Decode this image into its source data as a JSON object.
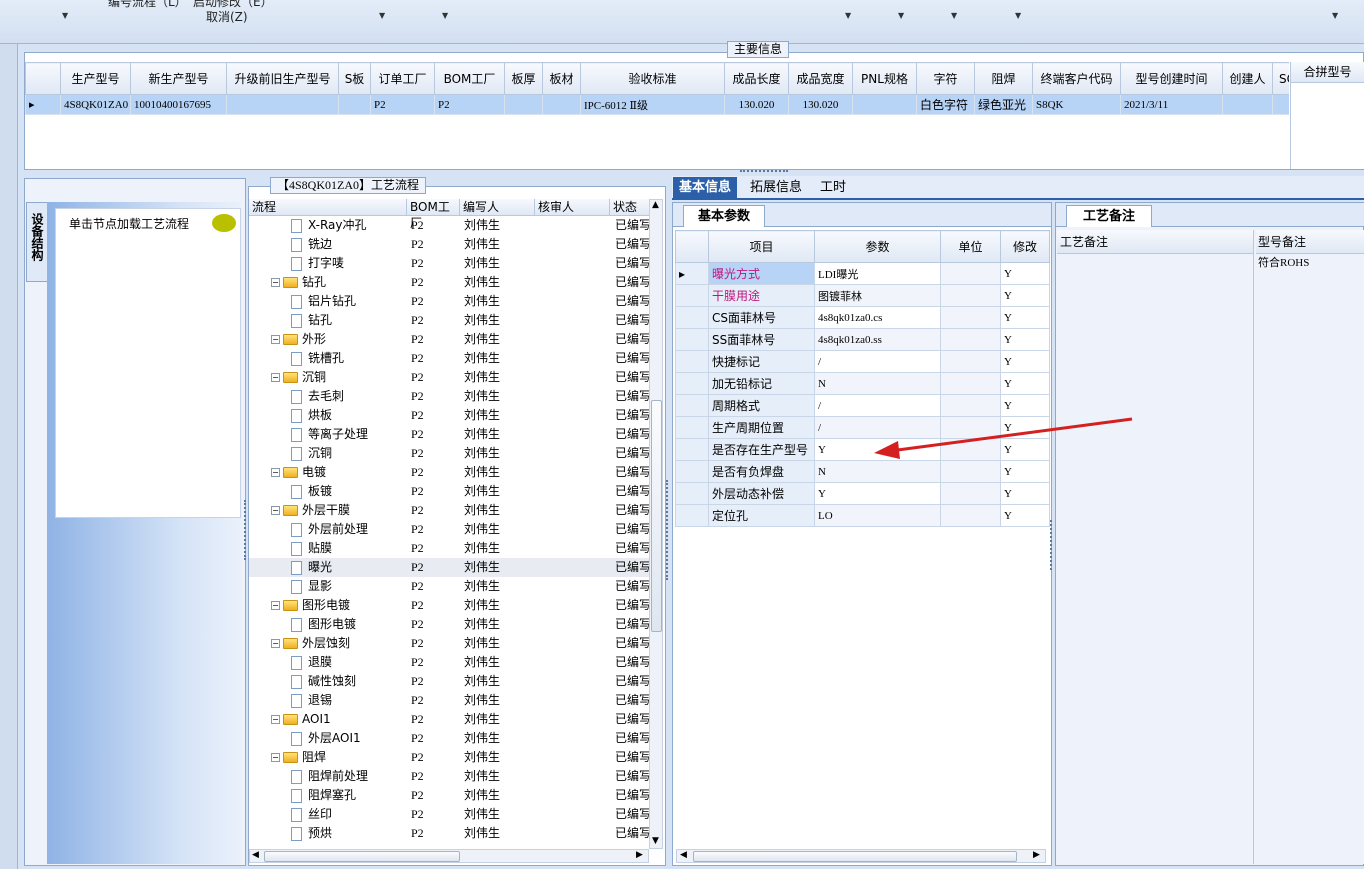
{
  "toolbar": {
    "item1": "编号流程（L）",
    "item2": "启动修改（E）",
    "cancel": "取消(Z)"
  },
  "main_info": {
    "legend": "主要信息",
    "columns": [
      "生产型号",
      "新生产型号",
      "升级前旧生产型号",
      "S板",
      "订单工厂",
      "BOM工厂",
      "板厚",
      "板材",
      "验收标准",
      "成品长度",
      "成品宽度",
      "PNL规格",
      "字符",
      "阻焊",
      "终端客户代码",
      "型号创建时间",
      "创建人",
      "SO"
    ],
    "row": [
      "4S8QK01ZA0",
      "10010400167695",
      "",
      "",
      "P2",
      "P2",
      "",
      "",
      "IPC-6012 Ⅱ级",
      "130.020",
      "130.020",
      "",
      "白色字符",
      "绿色亚光",
      "S8QK",
      "2021/3/11",
      "",
      ""
    ],
    "merge_header": "合拼型号"
  },
  "left_panel": {
    "vertical_tab": "设备结构",
    "hint": "单击节点加载工艺流程"
  },
  "process_flow": {
    "legend": "【4S8QK01ZA0】工艺流程",
    "columns": [
      "流程",
      "BOM工厂",
      "编写人",
      "核审人",
      "状态"
    ],
    "rows": [
      {
        "level": 2,
        "type": "doc",
        "name": "X-Ray冲孔",
        "bom": "P2",
        "writer": "刘伟生",
        "status": "已编写"
      },
      {
        "level": 2,
        "type": "doc",
        "name": "铣边",
        "bom": "P2",
        "writer": "刘伟生",
        "status": "已编写"
      },
      {
        "level": 2,
        "type": "doc",
        "name": "打字唛",
        "bom": "P2",
        "writer": "刘伟生",
        "status": "已编写"
      },
      {
        "level": 1,
        "type": "folder",
        "name": "钻孔",
        "bom": "P2",
        "writer": "刘伟生",
        "status": "已编写"
      },
      {
        "level": 2,
        "type": "doc",
        "name": "铝片钻孔",
        "bom": "P2",
        "writer": "刘伟生",
        "status": "已编写"
      },
      {
        "level": 2,
        "type": "doc",
        "name": "钻孔",
        "bom": "P2",
        "writer": "刘伟生",
        "status": "已编写"
      },
      {
        "level": 1,
        "type": "folder",
        "name": "外形",
        "bom": "P2",
        "writer": "刘伟生",
        "status": "已编写"
      },
      {
        "level": 2,
        "type": "doc",
        "name": "铣槽孔",
        "bom": "P2",
        "writer": "刘伟生",
        "status": "已编写"
      },
      {
        "level": 1,
        "type": "folder",
        "name": "沉铜",
        "bom": "P2",
        "writer": "刘伟生",
        "status": "已编写"
      },
      {
        "level": 2,
        "type": "doc",
        "name": "去毛刺",
        "bom": "P2",
        "writer": "刘伟生",
        "status": "已编写"
      },
      {
        "level": 2,
        "type": "doc",
        "name": "烘板",
        "bom": "P2",
        "writer": "刘伟生",
        "status": "已编写"
      },
      {
        "level": 2,
        "type": "doc",
        "name": "等离子处理",
        "bom": "P2",
        "writer": "刘伟生",
        "status": "已编写"
      },
      {
        "level": 2,
        "type": "doc",
        "name": "沉铜",
        "bom": "P2",
        "writer": "刘伟生",
        "status": "已编写"
      },
      {
        "level": 1,
        "type": "folder",
        "name": "电镀",
        "bom": "P2",
        "writer": "刘伟生",
        "status": "已编写"
      },
      {
        "level": 2,
        "type": "doc",
        "name": "板镀",
        "bom": "P2",
        "writer": "刘伟生",
        "status": "已编写"
      },
      {
        "level": 1,
        "type": "folder",
        "name": "外层干膜",
        "bom": "P2",
        "writer": "刘伟生",
        "status": "已编写"
      },
      {
        "level": 2,
        "type": "doc",
        "name": "外层前处理",
        "bom": "P2",
        "writer": "刘伟生",
        "status": "已编写"
      },
      {
        "level": 2,
        "type": "doc",
        "name": "贴膜",
        "bom": "P2",
        "writer": "刘伟生",
        "status": "已编写"
      },
      {
        "level": 2,
        "type": "doc",
        "name": "曝光",
        "bom": "P2",
        "writer": "刘伟生",
        "status": "已编写",
        "selected": true
      },
      {
        "level": 2,
        "type": "doc",
        "name": "显影",
        "bom": "P2",
        "writer": "刘伟生",
        "status": "已编写"
      },
      {
        "level": 1,
        "type": "folder",
        "name": "图形电镀",
        "bom": "P2",
        "writer": "刘伟生",
        "status": "已编写"
      },
      {
        "level": 2,
        "type": "doc",
        "name": "图形电镀",
        "bom": "P2",
        "writer": "刘伟生",
        "status": "已编写"
      },
      {
        "level": 1,
        "type": "folder",
        "name": "外层蚀刻",
        "bom": "P2",
        "writer": "刘伟生",
        "status": "已编写"
      },
      {
        "level": 2,
        "type": "doc",
        "name": "退膜",
        "bom": "P2",
        "writer": "刘伟生",
        "status": "已编写"
      },
      {
        "level": 2,
        "type": "doc",
        "name": "碱性蚀刻",
        "bom": "P2",
        "writer": "刘伟生",
        "status": "已编写"
      },
      {
        "level": 2,
        "type": "doc",
        "name": "退锡",
        "bom": "P2",
        "writer": "刘伟生",
        "status": "已编写"
      },
      {
        "level": 1,
        "type": "folder",
        "name": "AOI1",
        "bom": "P2",
        "writer": "刘伟生",
        "status": "已编写"
      },
      {
        "level": 2,
        "type": "doc",
        "name": "外层AOI1",
        "bom": "P2",
        "writer": "刘伟生",
        "status": "已编写"
      },
      {
        "level": 1,
        "type": "folder",
        "name": "阻焊",
        "bom": "P2",
        "writer": "刘伟生",
        "status": "已编写"
      },
      {
        "level": 2,
        "type": "doc",
        "name": "阻焊前处理",
        "bom": "P2",
        "writer": "刘伟生",
        "status": "已编写"
      },
      {
        "level": 2,
        "type": "doc",
        "name": "阻焊塞孔",
        "bom": "P2",
        "writer": "刘伟生",
        "status": "已编写"
      },
      {
        "level": 2,
        "type": "doc",
        "name": "丝印",
        "bom": "P2",
        "writer": "刘伟生",
        "status": "已编写"
      },
      {
        "level": 2,
        "type": "doc",
        "name": "预烘",
        "bom": "P2",
        "writer": "刘伟生",
        "status": "已编写"
      }
    ]
  },
  "tabs": [
    "基本信息",
    "拓展信息",
    "工时"
  ],
  "basic_params": {
    "subtab": "基本参数",
    "columns": [
      "项目",
      "参数",
      "单位",
      "修改"
    ],
    "rows": [
      {
        "item": "曝光方式",
        "param": "LDI曝光",
        "unit": "",
        "edit": "Y",
        "pink": true,
        "current": true
      },
      {
        "item": "干膜用途",
        "param": "图镀菲林",
        "unit": "",
        "edit": "Y",
        "pink": true
      },
      {
        "item": "CS面菲林号",
        "param": "4s8qk01za0.cs",
        "unit": "",
        "edit": "Y"
      },
      {
        "item": "SS面菲林号",
        "param": "4s8qk01za0.ss",
        "unit": "",
        "edit": "Y"
      },
      {
        "item": "快捷标记",
        "param": "/",
        "unit": "",
        "edit": "Y"
      },
      {
        "item": "加无铅标记",
        "param": "N",
        "unit": "",
        "edit": "Y"
      },
      {
        "item": "周期格式",
        "param": "/",
        "unit": "",
        "edit": "Y"
      },
      {
        "item": "生产周期位置",
        "param": "/",
        "unit": "",
        "edit": "Y"
      },
      {
        "item": "是否存在生产型号",
        "param": "Y",
        "unit": "",
        "edit": "Y"
      },
      {
        "item": "是否有负焊盘",
        "param": "N",
        "unit": "",
        "edit": "Y"
      },
      {
        "item": "外层动态补偿",
        "param": "Y",
        "unit": "",
        "edit": "Y"
      },
      {
        "item": "定位孔",
        "param": "LO",
        "unit": "",
        "edit": "Y"
      }
    ]
  },
  "remarks": {
    "subtab": "工艺备注",
    "col1": "工艺备注",
    "col2": "型号备注",
    "model_remark": "符合ROHS"
  },
  "colors": {
    "accent": "#2b5fa8",
    "selection": "#b7d3f5",
    "pink": "#c0157f",
    "arrow": "#d42020"
  }
}
